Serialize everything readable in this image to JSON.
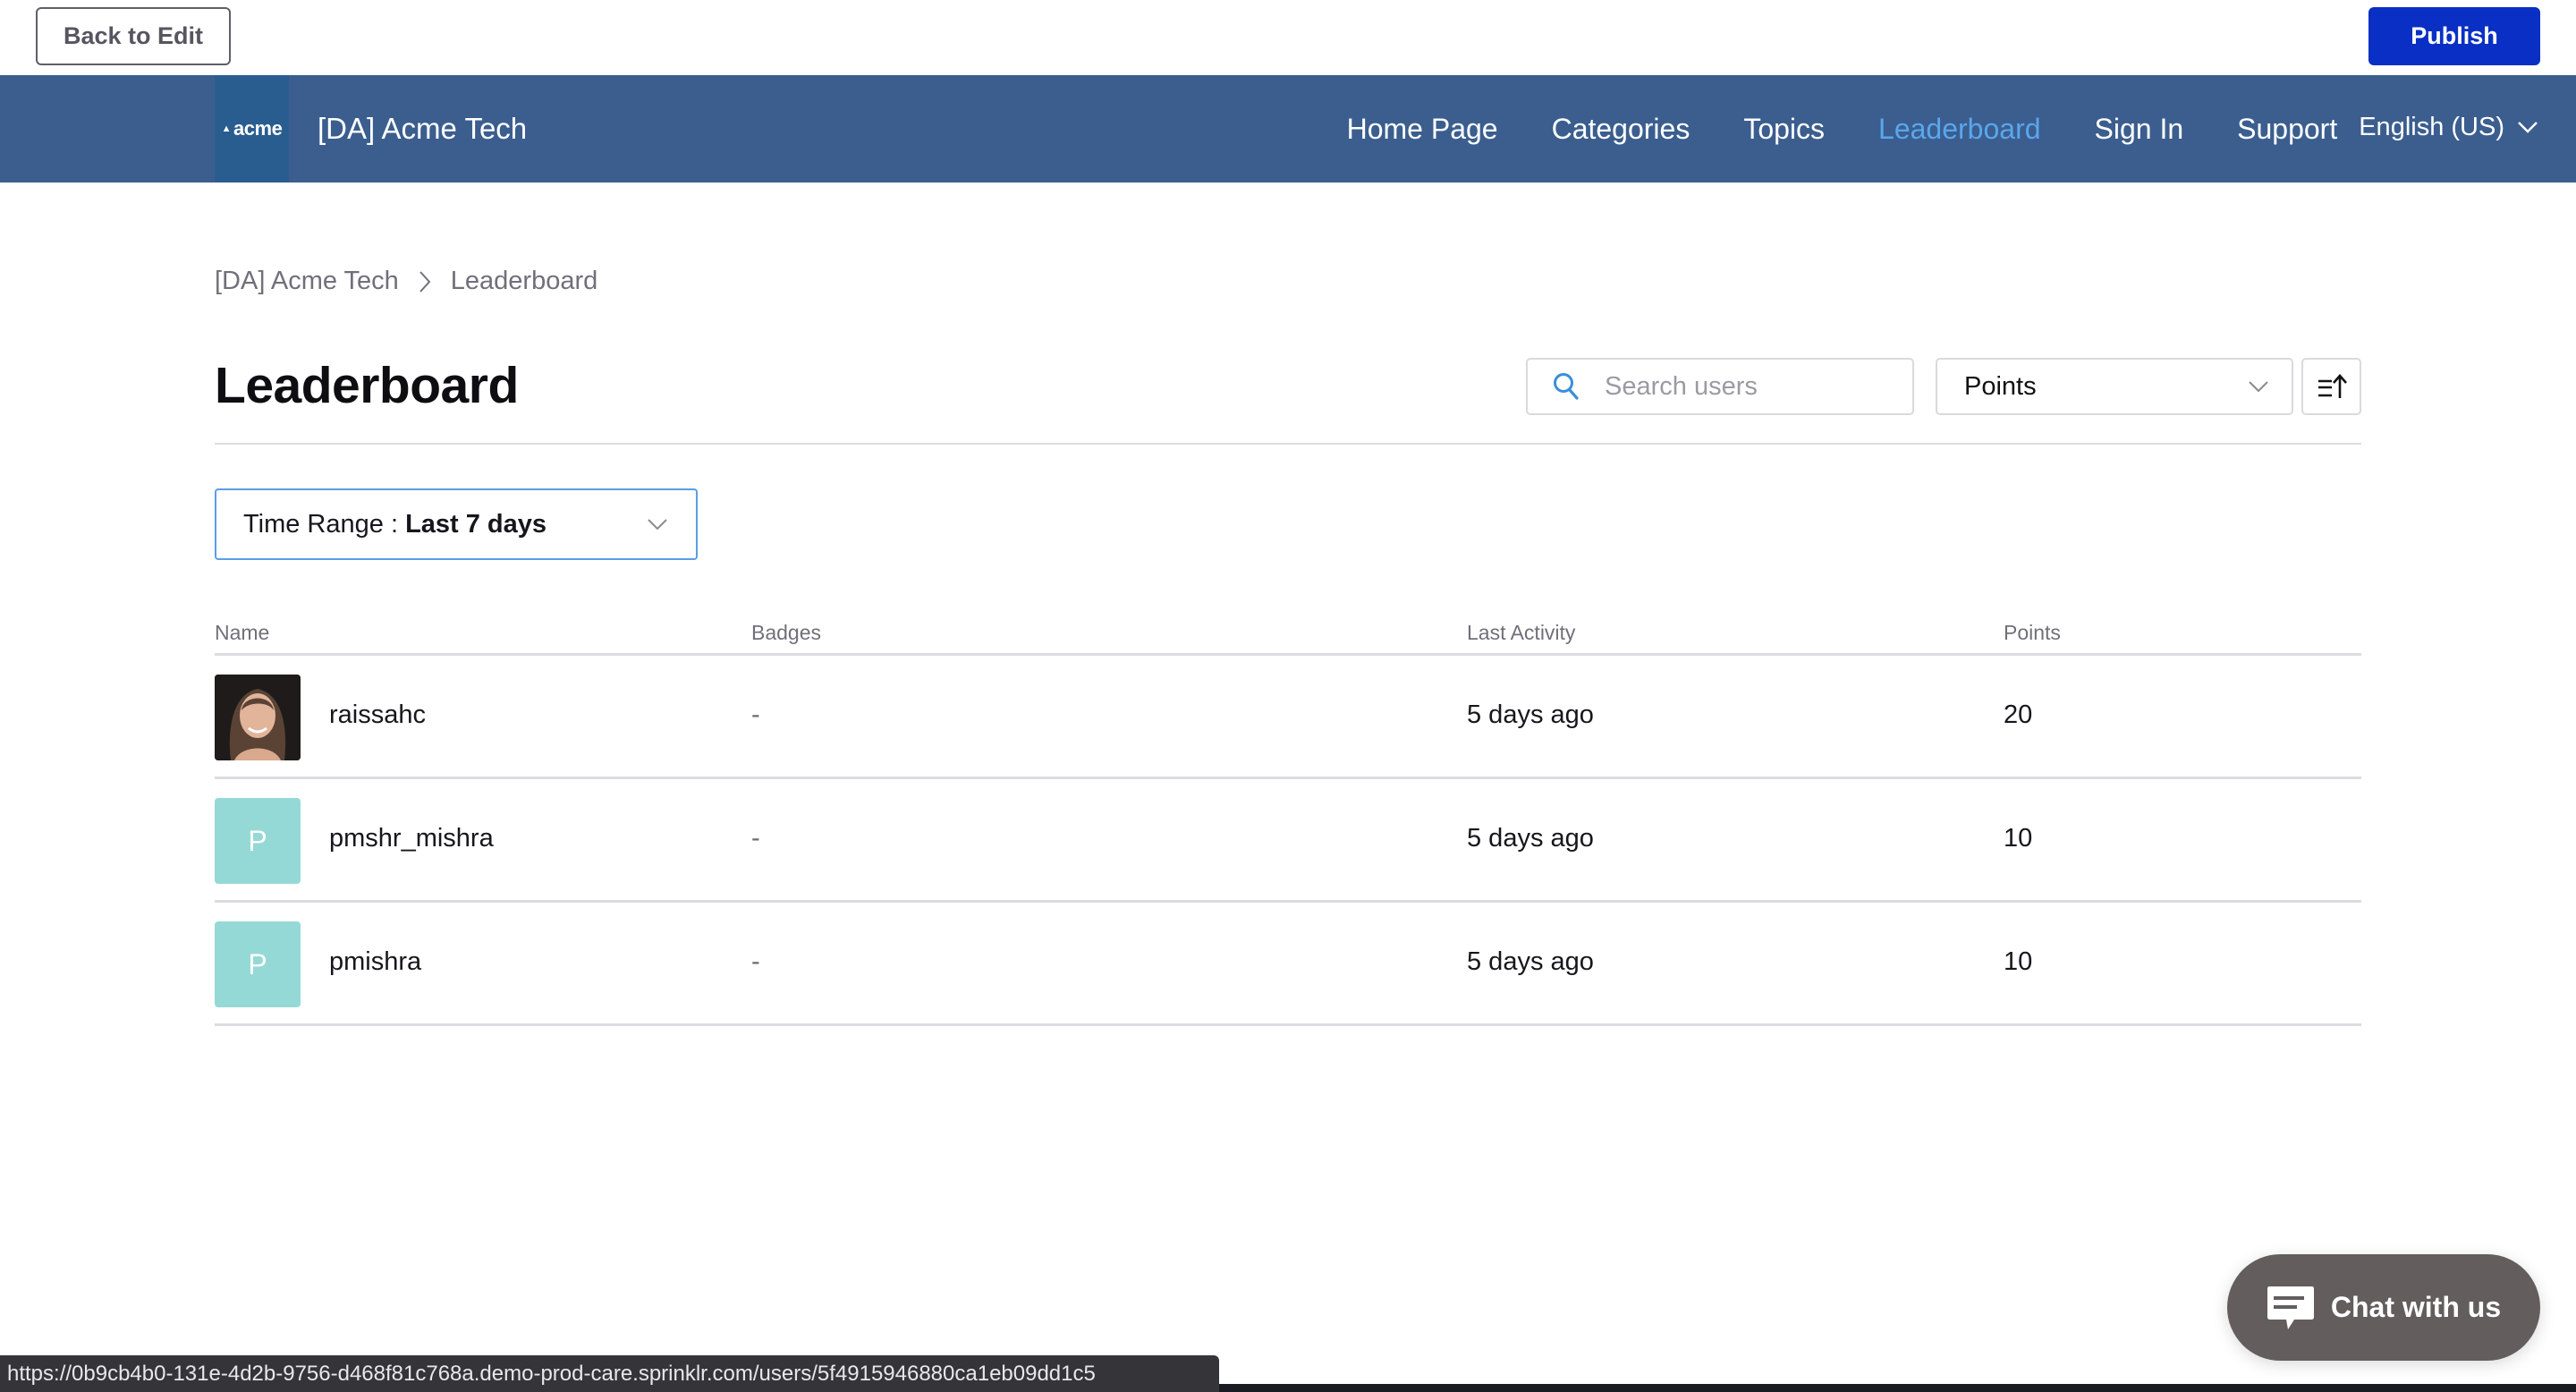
{
  "editor_bar": {
    "back_label": "Back to Edit",
    "publish_label": "Publish",
    "publish_color": "#0a2fc4"
  },
  "nav": {
    "logo_text": "acme",
    "site_title": "[DA] Acme Tech",
    "background": "#3b5e8f",
    "links": [
      {
        "label": "Home Page",
        "active": false
      },
      {
        "label": "Categories",
        "active": false
      },
      {
        "label": "Topics",
        "active": false
      },
      {
        "label": "Leaderboard",
        "active": true
      },
      {
        "label": "Sign In",
        "active": false
      },
      {
        "label": "Support",
        "active": false
      }
    ],
    "language": "English (US)",
    "active_color": "#5aa6ec"
  },
  "breadcrumb": {
    "items": [
      "[DA] Acme Tech",
      "Leaderboard"
    ]
  },
  "page": {
    "title": "Leaderboard",
    "search_placeholder": "Search users",
    "search_value": "",
    "sort_by": "Points",
    "sort_direction_icon": "sort-ascending-icon",
    "time_range_label": "Time Range : ",
    "time_range_value": "Last 7 days"
  },
  "table": {
    "columns": [
      "Name",
      "Badges",
      "Last Activity",
      "Points"
    ],
    "rows": [
      {
        "avatar": "photo",
        "initial": "",
        "name": "raissahc",
        "badges": "-",
        "last_activity": "5 days ago",
        "points": "20"
      },
      {
        "avatar": "initial",
        "initial": "P",
        "name": "pmshr_mishra",
        "badges": "-",
        "last_activity": "5 days ago",
        "points": "10"
      },
      {
        "avatar": "initial",
        "initial": "P",
        "name": "pmishra",
        "badges": "-",
        "last_activity": "5 days ago",
        "points": "10"
      }
    ]
  },
  "chat": {
    "label": "Chat with us"
  },
  "status_bar": {
    "url": "https://0b9cb4b0-131e-4d2b-9756-d468f81c768a.demo-prod-care.sprinklr.com/users/5f4915946880ca1eb09dd1c5"
  }
}
